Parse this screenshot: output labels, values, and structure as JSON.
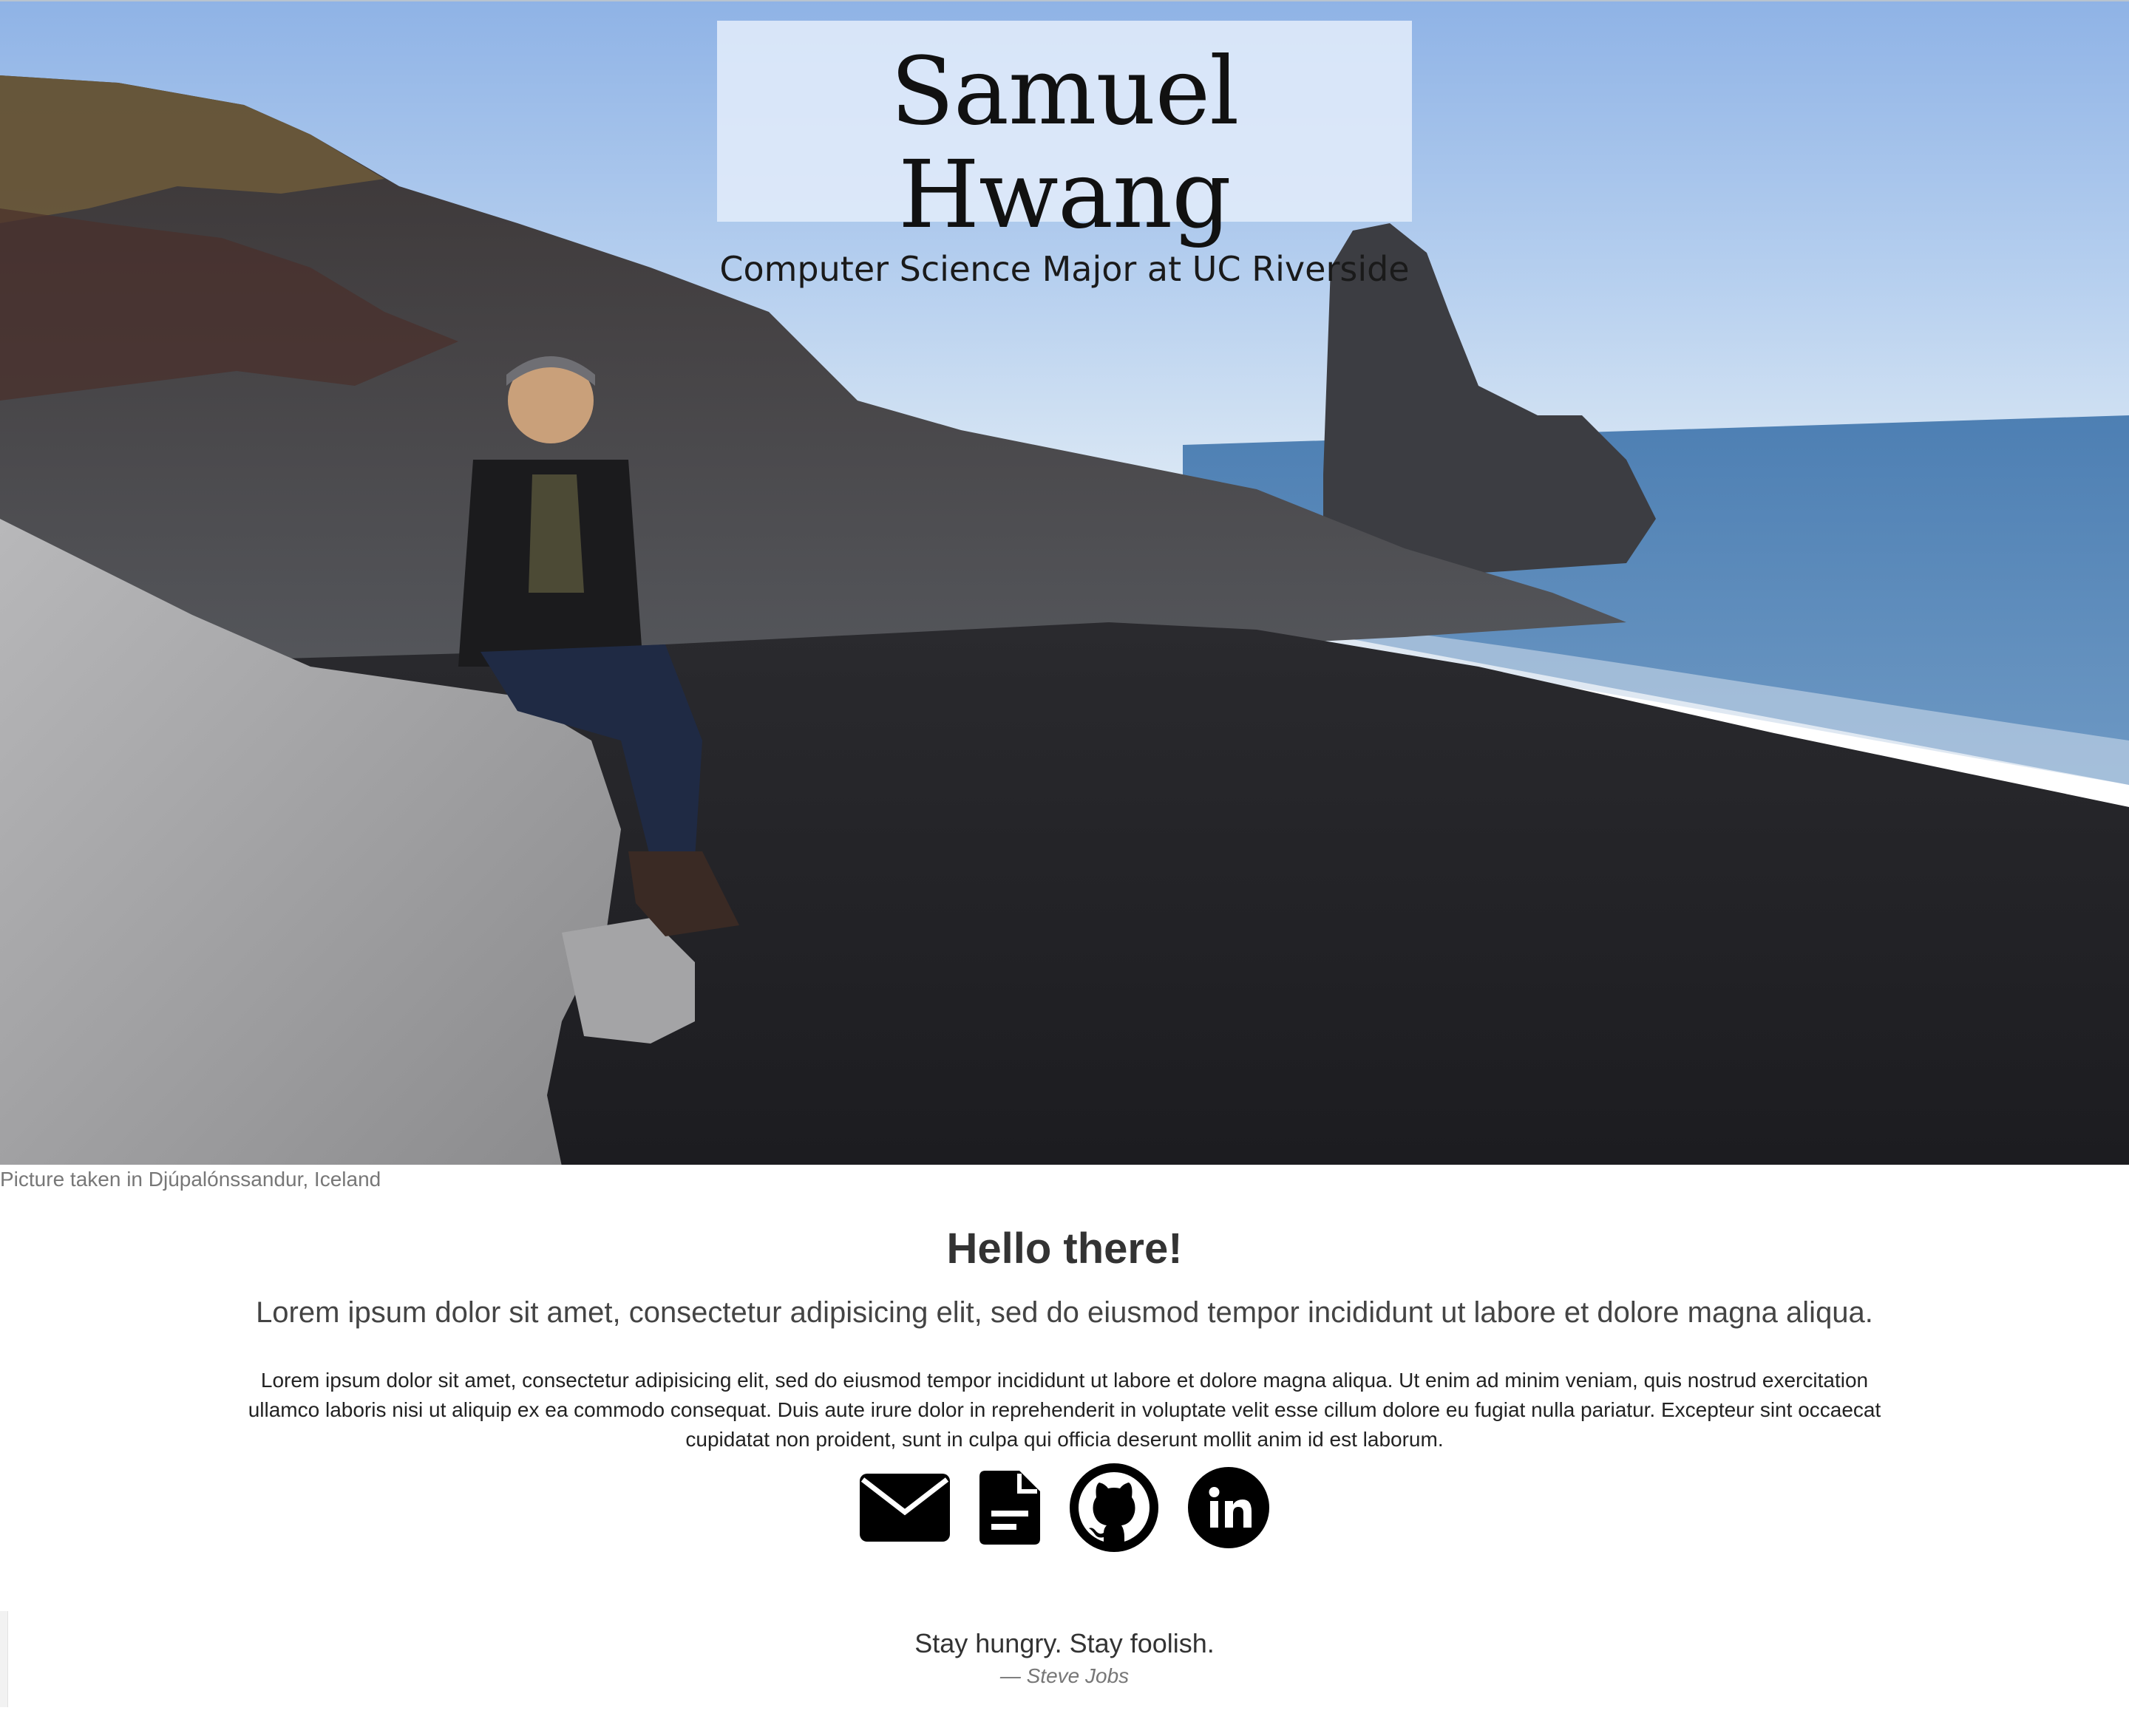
{
  "hero": {
    "name": "Samuel Hwang",
    "subtitle": "Computer Science Major at UC Riverside",
    "caption": "Picture taken in Djúpalónssandur, Iceland"
  },
  "main": {
    "heading": "Hello there!",
    "lead": "Lorem ipsum dolor sit amet, consectetur adipisicing elit, sed do eiusmod tempor incididunt ut labore et dolore magna aliqua.",
    "body": "Lorem ipsum dolor sit amet, consectetur adipisicing elit, sed do eiusmod tempor incididunt ut labore et dolore magna aliqua. Ut enim ad minim veniam, quis nostrud exercitation ullamco laboris nisi ut aliquip ex ea commodo consequat. Duis aute irure dolor in reprehenderit in voluptate velit esse cillum dolore eu fugiat nulla pariatur. Excepteur sint occaecat cupidatat non proident, sunt in culpa qui officia deserunt mollit anim id est laborum."
  },
  "social_icons": [
    "envelope-icon",
    "document-icon",
    "github-icon",
    "linkedin-icon"
  ],
  "quote": {
    "text": "Stay hungry. Stay foolish.",
    "author": "— Steve Jobs"
  },
  "colors": {
    "title_box_bg": "#e1ecfa",
    "caption": "#777777",
    "text": "#333333",
    "icon": "#000000"
  }
}
